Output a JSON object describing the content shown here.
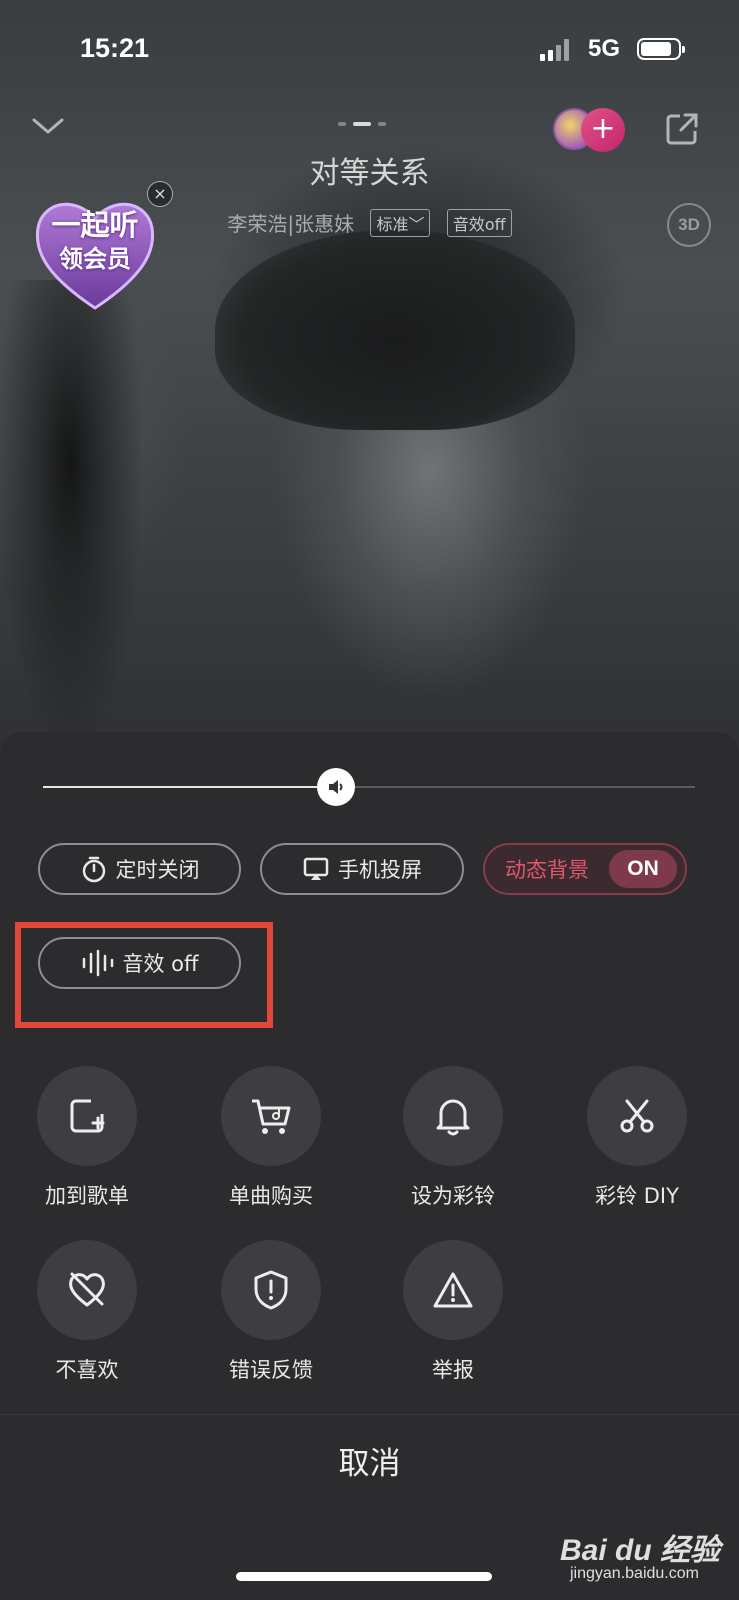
{
  "status_bar": {
    "time": "15:21",
    "network": "5G"
  },
  "header": {
    "song_title": "对等关系",
    "artists": "李荣浩|张惠妹",
    "quality_tag": "标准﹀",
    "effect_tag": "音效off",
    "badge_3d": "3D"
  },
  "promo": {
    "line1": "一起听",
    "line2": "领会员",
    "close": "×"
  },
  "volume": {
    "level": 0.45
  },
  "controls": {
    "timer_label": "定时关闭",
    "cast_label": "手机投屏",
    "dynamic_bg_label": "动态背景",
    "dynamic_bg_state": "ON",
    "sound_effect_label": "音效 off"
  },
  "actions": [
    {
      "label": "加到歌单",
      "icon": "add-to-playlist-icon"
    },
    {
      "label": "单曲购买",
      "icon": "cart-icon"
    },
    {
      "label": "设为彩铃",
      "icon": "bell-icon"
    },
    {
      "label": "彩铃 DIY",
      "icon": "scissors-icon"
    },
    {
      "label": "不喜欢",
      "icon": "dislike-heart-icon"
    },
    {
      "label": "错误反馈",
      "icon": "shield-alert-icon"
    },
    {
      "label": "举报",
      "icon": "warning-icon"
    }
  ],
  "cancel_label": "取消",
  "colors": {
    "sheet": "#2c2c2f",
    "accent": "#e0566d",
    "highlight": "#e2473a"
  },
  "watermark": {
    "brand": "Bai du 经验",
    "url": "jingyan.baidu.com"
  }
}
